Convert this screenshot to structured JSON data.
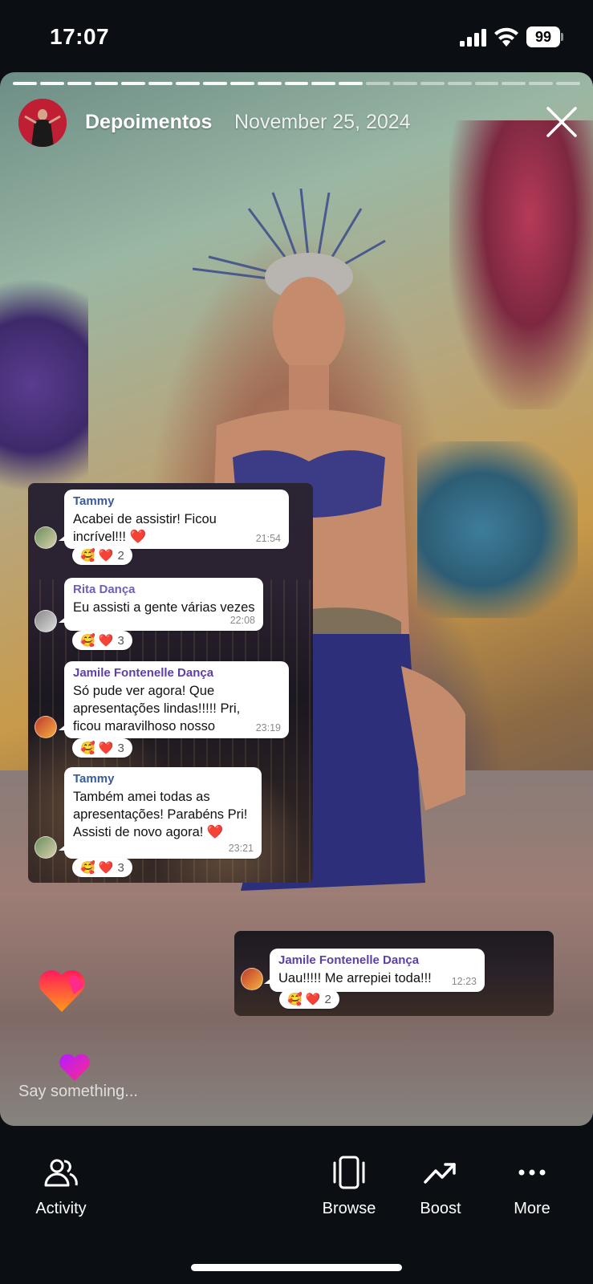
{
  "status_bar": {
    "time": "17:07",
    "battery": "99"
  },
  "story": {
    "title": "Depoimentos",
    "date": "November 25, 2024",
    "progress": {
      "segments": 21,
      "completed": 13
    }
  },
  "chat": {
    "messages": [
      {
        "sender": "Tammy",
        "text": "Acabei de assistir! Ficou incrível!!! ❤️",
        "time": "21:54",
        "reactions": "🥰 ❤️",
        "count": "2"
      },
      {
        "sender": "Rita Dança",
        "text": "Eu assisti a gente várias vezes",
        "time": "22:08",
        "reactions": "🥰 ❤️",
        "count": "3"
      },
      {
        "sender": "Jamile Fontenelle Dança",
        "text": "Só pude ver agora! Que apresentações lindas!!!!! Pri, ficou maravilhoso nosso vídeo!!!!!",
        "time": "23:19",
        "reactions": "🥰 ❤️",
        "count": "3"
      },
      {
        "sender": "Tammy",
        "text": "Também amei todas as apresentações! Parabéns Pri! Assisti de novo agora! ❤️",
        "time": "23:21",
        "reactions": "🥰 ❤️",
        "count": "3"
      }
    ],
    "second": {
      "sender": "Jamile Fontenelle Dança",
      "text": "Uau!!!!! Me arrepiei toda!!!",
      "time": "12:23",
      "reactions": "🥰 ❤️",
      "count": "2"
    }
  },
  "reply": {
    "placeholder": "Say something..."
  },
  "bottom_nav": {
    "activity": "Activity",
    "browse": "Browse",
    "boost": "Boost",
    "more": "More"
  },
  "colors": {
    "background": "#0b0f14",
    "accent_sender": "#3a5a9c",
    "heart": "#ff3b30"
  }
}
